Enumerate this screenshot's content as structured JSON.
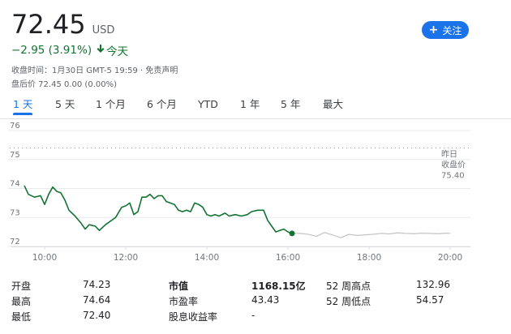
{
  "quote": {
    "price": "72.45",
    "currency": "USD",
    "change": "−2.95 (3.91%)",
    "change_period": "今天",
    "close_info": "收盘时间：1月30日 GMT-5 19:59 · ",
    "disclaimer": "免责声明",
    "after_hours": "盘后价 72.45 0.00 (0.00%)",
    "follow_label": "关注",
    "colors": {
      "positive": "#137333",
      "accent": "#1a73e8",
      "after_hours_line": "#c6c6c6"
    }
  },
  "tabs": [
    {
      "label": "1 天",
      "active": true
    },
    {
      "label": "5 天",
      "active": false
    },
    {
      "label": "1 个月",
      "active": false
    },
    {
      "label": "6 个月",
      "active": false
    },
    {
      "label": "YTD",
      "active": false
    },
    {
      "label": "1 年",
      "active": false
    },
    {
      "label": "5 年",
      "active": false
    },
    {
      "label": "最大",
      "active": false
    }
  ],
  "chart_data": {
    "type": "line",
    "ylim": [
      72,
      76
    ],
    "yticks": [
      "72",
      "73",
      "74",
      "75",
      "76"
    ],
    "xlim": [
      9.5,
      20.5
    ],
    "xticks": [
      {
        "value": 10,
        "label": "10:00"
      },
      {
        "value": 12,
        "label": "12:00"
      },
      {
        "value": 14,
        "label": "14:00"
      },
      {
        "value": 16,
        "label": "16:00"
      },
      {
        "value": 18,
        "label": "18:00"
      },
      {
        "value": 20,
        "label": "20:00"
      }
    ],
    "previous_close": {
      "label_line1": "昨日",
      "label_line2": "收盘价",
      "value": 75.4,
      "value_text": "75.40"
    },
    "series": [
      {
        "session": "regular",
        "points": [
          [
            9.5,
            74.1
          ],
          [
            9.6,
            73.8
          ],
          [
            9.75,
            73.7
          ],
          [
            9.9,
            73.75
          ],
          [
            10.0,
            73.45
          ],
          [
            10.1,
            73.8
          ],
          [
            10.2,
            74.05
          ],
          [
            10.3,
            73.9
          ],
          [
            10.4,
            73.85
          ],
          [
            10.5,
            73.6
          ],
          [
            10.6,
            73.25
          ],
          [
            10.75,
            73.05
          ],
          [
            10.9,
            72.8
          ],
          [
            11.0,
            72.6
          ],
          [
            11.1,
            72.75
          ],
          [
            11.25,
            72.7
          ],
          [
            11.35,
            72.55
          ],
          [
            11.5,
            72.75
          ],
          [
            11.6,
            72.85
          ],
          [
            11.75,
            73.0
          ],
          [
            11.9,
            73.35
          ],
          [
            12.0,
            73.4
          ],
          [
            12.1,
            73.5
          ],
          [
            12.2,
            73.1
          ],
          [
            12.3,
            73.2
          ],
          [
            12.4,
            73.7
          ],
          [
            12.5,
            73.7
          ],
          [
            12.6,
            73.8
          ],
          [
            12.7,
            73.65
          ],
          [
            12.8,
            73.75
          ],
          [
            12.9,
            73.75
          ],
          [
            13.0,
            73.55
          ],
          [
            13.1,
            73.5
          ],
          [
            13.2,
            73.45
          ],
          [
            13.3,
            73.25
          ],
          [
            13.4,
            73.2
          ],
          [
            13.5,
            73.25
          ],
          [
            13.6,
            73.2
          ],
          [
            13.7,
            73.5
          ],
          [
            13.8,
            73.45
          ],
          [
            13.9,
            73.35
          ],
          [
            14.0,
            73.1
          ],
          [
            14.1,
            73.05
          ],
          [
            14.2,
            73.1
          ],
          [
            14.3,
            73.05
          ],
          [
            14.45,
            73.15
          ],
          [
            14.55,
            73.05
          ],
          [
            14.7,
            73.1
          ],
          [
            14.85,
            73.05
          ],
          [
            15.0,
            73.1
          ],
          [
            15.1,
            73.2
          ],
          [
            15.25,
            73.25
          ],
          [
            15.4,
            73.25
          ],
          [
            15.5,
            72.9
          ],
          [
            15.6,
            72.7
          ],
          [
            15.7,
            72.5
          ],
          [
            15.8,
            72.55
          ],
          [
            15.9,
            72.6
          ],
          [
            16.0,
            72.5
          ],
          [
            16.1,
            72.45
          ]
        ]
      },
      {
        "session": "after_hours",
        "points": [
          [
            16.1,
            72.45
          ],
          [
            16.3,
            72.45
          ],
          [
            16.5,
            72.42
          ],
          [
            16.7,
            72.35
          ],
          [
            16.9,
            72.48
          ],
          [
            17.1,
            72.4
          ],
          [
            17.3,
            72.3
          ],
          [
            17.5,
            72.42
          ],
          [
            17.7,
            72.38
          ],
          [
            17.9,
            72.4
          ],
          [
            18.1,
            72.42
          ],
          [
            18.3,
            72.45
          ],
          [
            18.5,
            72.43
          ],
          [
            18.7,
            72.47
          ],
          [
            18.9,
            72.45
          ],
          [
            19.1,
            72.44
          ],
          [
            19.3,
            72.46
          ],
          [
            19.5,
            72.45
          ],
          [
            19.7,
            72.44
          ],
          [
            19.9,
            72.46
          ],
          [
            20.0,
            72.45
          ]
        ]
      }
    ]
  },
  "stats": [
    [
      {
        "label": "开盘",
        "value": "74.23"
      },
      {
        "label": "市值",
        "value": "1168.15亿",
        "bold": true
      },
      {
        "label": "52 周高点",
        "value": "132.96"
      }
    ],
    [
      {
        "label": "最高",
        "value": "74.64"
      },
      {
        "label": "市盈率",
        "value": "43.43"
      },
      {
        "label": "52 周低点",
        "value": "54.57"
      }
    ],
    [
      {
        "label": "最低",
        "value": "72.40"
      },
      {
        "label": "股息收益率",
        "value": "-"
      }
    ]
  ]
}
